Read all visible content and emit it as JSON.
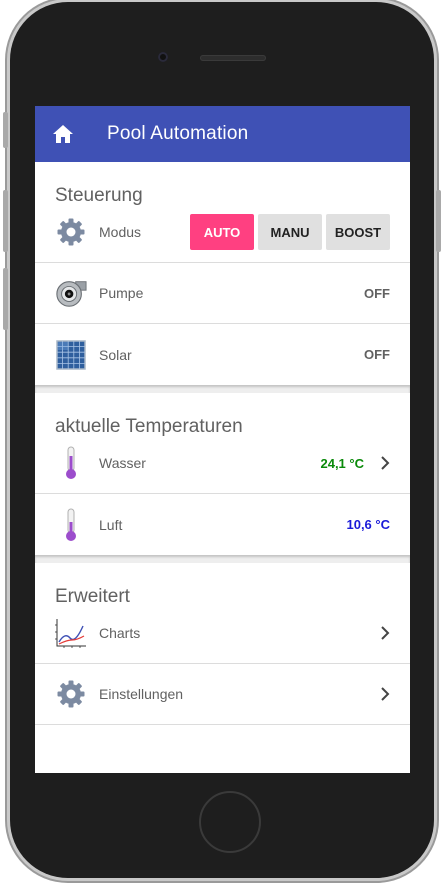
{
  "appbar": {
    "title": "Pool Automation",
    "icon": "home-icon"
  },
  "steuerung": {
    "title": "Steuerung",
    "modus": {
      "label": "Modus",
      "buttons": [
        "AUTO",
        "MANU",
        "BOOST"
      ],
      "active": "AUTO"
    },
    "pumpe": {
      "label": "Pumpe",
      "value": "OFF"
    },
    "solar": {
      "label": "Solar",
      "value": "OFF"
    }
  },
  "temperaturen": {
    "title": "aktuelle Temperaturen",
    "wasser": {
      "label": "Wasser",
      "value": "24,1 °C",
      "color": "#0a8a0a"
    },
    "luft": {
      "label": "Luft",
      "value": "10,6 °C",
      "color": "#1a1ad8"
    }
  },
  "erweitert": {
    "title": "Erweitert",
    "charts": {
      "label": "Charts"
    },
    "einstellungen": {
      "label": "Einstellungen"
    }
  },
  "colors": {
    "primary": "#3f51b5",
    "accent": "#ff4081"
  }
}
